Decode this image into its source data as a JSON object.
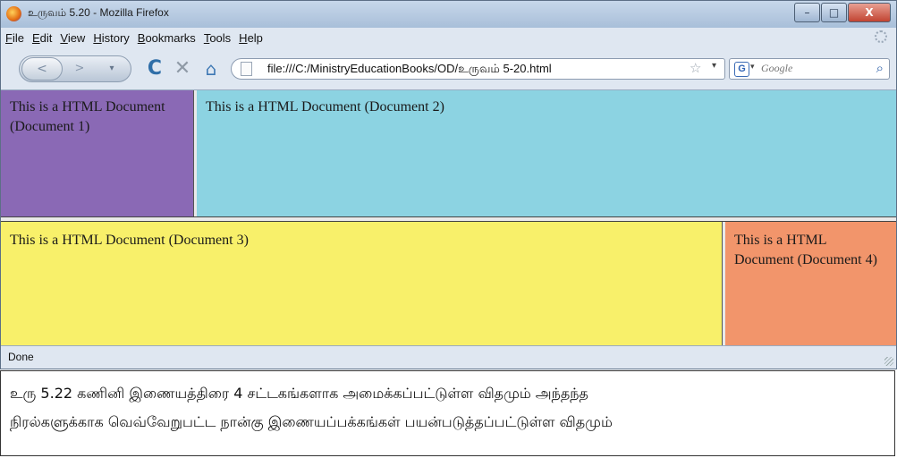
{
  "window": {
    "title": "உருவம் 5.20 - Mozilla Firefox",
    "controls": {
      "minimize": "–",
      "maximize": "□",
      "close": "X"
    }
  },
  "menubar": {
    "items": [
      "File",
      "Edit",
      "View",
      "History",
      "Bookmarks",
      "Tools",
      "Help"
    ]
  },
  "navbar": {
    "back_glyph": "<",
    "forward_glyph": ">",
    "history_glyph": "▾",
    "reload_glyph": "C",
    "stop_glyph": "✕",
    "home_glyph": "⌂",
    "url": "file:///C:/MinistryEducationBooks/OD/உருவம் 5-20.html",
    "star_glyph": "☆",
    "url_dropdown_glyph": "▾",
    "search_engine_glyph": "G",
    "search_dropdown_glyph": "▾",
    "search_placeholder": "Google",
    "search_go_glyph": "⌕"
  },
  "frames": {
    "doc1": "This is a HTML Document (Document 1)",
    "doc2": "This is a HTML Document (Document 2)",
    "doc3": "This is a HTML Document (Document 3)",
    "doc4": "This is a HTML Document (Document 4)"
  },
  "status": {
    "text": "Done"
  },
  "caption": {
    "line1": "உரு 5.22 கணினி இணையத்திரை 4 சட்டகங்களாக அமைக்கப்பட்டுள்ள விதமும் அந்தந்த",
    "line2": "நிரல்களுக்காக வெவ்வேறுபட்ட நான்கு இணையப்பக்கங்கள் பயன்படுத்தப்பட்டுள்ள விதமும்"
  },
  "colors": {
    "frame1": "#8a69b5",
    "frame2": "#8cd3e2",
    "frame3": "#f8f06a",
    "frame4": "#f2956b",
    "chrome": "#dfe7f1"
  }
}
